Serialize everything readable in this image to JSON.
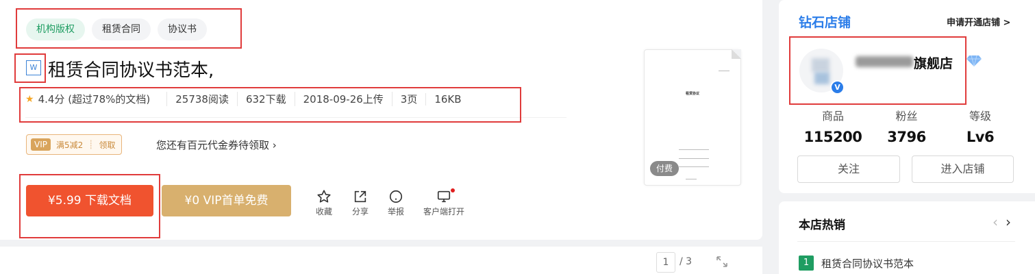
{
  "tags": [
    "机构版权",
    "租赁合同",
    "协议书"
  ],
  "doc": {
    "type_icon": "W",
    "title": "租赁合同协议书范本,",
    "rating": "4.4分",
    "rating_note": "(超过78%的文档)",
    "reads": "25738阅读",
    "downloads": "632下载",
    "upload_date": "2018-09-26上传",
    "pages": "3页",
    "size": "16KB"
  },
  "coupon": {
    "vip": "VIP",
    "discount": "满5减2",
    "claim": "领取",
    "promo_text": "您还有百元代金券待领取 ›"
  },
  "actions": {
    "download": "¥5.99 下载文档",
    "vip_free": "¥0 VIP首单免费",
    "favorite": "收藏",
    "share": "分享",
    "report": "举报",
    "client_open": "客户端打开"
  },
  "preview": {
    "thumb_title": "租赁协议",
    "paid_badge": "付费"
  },
  "pager": {
    "current": "1",
    "total": "/ 3"
  },
  "shop": {
    "level": "钻石店铺",
    "apply": "申请开通店铺 >",
    "name_suffix": "旗舰店",
    "verify_mark": "V",
    "stats": [
      {
        "label": "商品",
        "value": "115200"
      },
      {
        "label": "粉丝",
        "value": "3796"
      },
      {
        "label": "等级",
        "value": "Lv6"
      }
    ],
    "follow": "关注",
    "enter": "进入店铺"
  },
  "hot": {
    "title": "本店热销",
    "prev": "‹",
    "next": "›",
    "items": [
      {
        "rank": "1",
        "title": "租赁合同协议书范本"
      }
    ]
  },
  "colors": {
    "download_button": "#f0532f",
    "vip_button": "#d8b06e",
    "shop_level": "#2b7de9",
    "tag_green": "#1f9d62",
    "annotation_red": "#e03b3b"
  }
}
